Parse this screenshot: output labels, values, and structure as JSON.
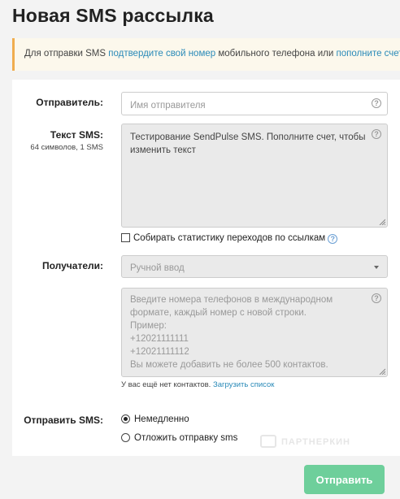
{
  "page": {
    "title": "Новая SMS рассылка"
  },
  "alert": {
    "text_1": "Для отправки SMS ",
    "link_confirm": "подтвердите свой номер",
    "text_2": " мобильного телефона или ",
    "link_topup": "пополните счет"
  },
  "form": {
    "sender": {
      "label": "Отправитель:",
      "placeholder": "Имя отправителя",
      "value": ""
    },
    "text": {
      "label": "Текст SMS:",
      "counter": "64 символов, 1 SMS",
      "value": "Тестирование SendPulse SMS. Пополните счет, чтобы изменить текст"
    },
    "collect_stats": {
      "label": "Собирать статистику переходов по ссылкам",
      "checked": false
    },
    "recipients": {
      "label": "Получатели:",
      "selected": "Ручной ввод",
      "phones_placeholder": [
        "Введите номера телефонов в международном",
        "формате, каждый номер с новой строки.",
        " Пример:",
        " +12021111111",
        " +12021111112",
        " Вы можете добавить не более 500 контактов."
      ],
      "no_contacts_text": "У вас ещё нет контактов. ",
      "upload_link": "Загрузить список"
    },
    "send_sms": {
      "label": "Отправить SMS:",
      "options": [
        {
          "label": "Немедленно",
          "checked": true
        },
        {
          "label": "Отложить отправку sms",
          "checked": false
        }
      ]
    },
    "help_icon_glyph": "?",
    "submit_label": "Отправить"
  },
  "watermark": "ПАРТНЕРКИН",
  "colors": {
    "accent_link": "#2a8ab8",
    "submit_bg": "#6ecf9b",
    "alert_border": "#f0ad4e"
  }
}
